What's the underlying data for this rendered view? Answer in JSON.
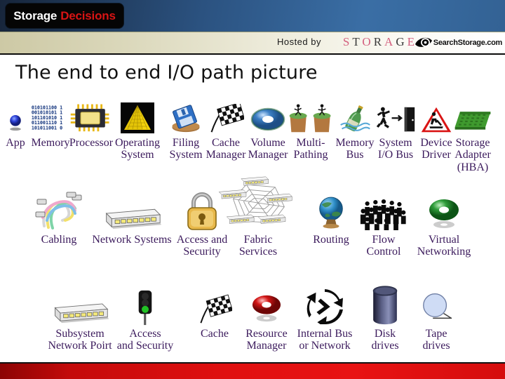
{
  "header": {
    "logo_primary": "Storage",
    "logo_secondary": "Decisions",
    "hosted_by": "Hosted by",
    "storage_word": "STORAGE",
    "search_brand": "SearchStorage.com",
    "colors": {
      "band_blue": "#2b5280",
      "band_tan": "#dbd8bb",
      "logo_red": "#d91414",
      "footer_red": "#e01010",
      "label_purple": "#3b1a5c"
    }
  },
  "slide": {
    "title": "The end to end I/O path picture"
  },
  "rows": [
    {
      "name": "host-io-path-row",
      "items": [
        {
          "label": "App",
          "icon": "blue-sphere-icon"
        },
        {
          "label": "Memory",
          "icon": "binary-digits-icon"
        },
        {
          "label": "Processor",
          "icon": "cpu-chip-icon"
        },
        {
          "label": "Operating\nSystem",
          "icon": "yellow-pyramid-icon"
        },
        {
          "label": "Filing\nSystem",
          "icon": "floppy-disk-icon"
        },
        {
          "label": "Cache\nManager",
          "icon": "checkered-flag-icon"
        },
        {
          "label": "Volume\nManager",
          "icon": "torus-ring-icon"
        },
        {
          "label": "Multi-\nPathing",
          "icon": "two-cliff-hikers-icon"
        },
        {
          "label": "Memory\nBus",
          "icon": "champagne-bottle-icon"
        },
        {
          "label": "System\nI/O Bus",
          "icon": "runner-door-icon"
        },
        {
          "label": "Device\nDriver",
          "icon": "roadworks-sign-icon"
        },
        {
          "label": "Storage\nAdapter\n(HBA)",
          "icon": "green-board-icon"
        }
      ]
    },
    {
      "name": "network-fabric-row",
      "items": [
        {
          "label": "Cabling",
          "icon": "tangled-cables-icon"
        },
        {
          "label": "Network Systems",
          "icon": "switch-device-icon"
        },
        {
          "label": "Access and\nSecurity",
          "icon": "padlock-icon"
        },
        {
          "label": "Fabric\nServices",
          "icon": "mesh-fabric-icon"
        },
        {
          "label": "Routing",
          "icon": "globe-icon"
        },
        {
          "label": "Flow\nControl",
          "icon": "crowd-people-icon"
        },
        {
          "label": "Virtual\nNetworking",
          "icon": "green-torus-icon"
        }
      ]
    },
    {
      "name": "storage-subsystem-row",
      "items": [
        {
          "label": "Subsystem\nNetwork Poirt",
          "icon": "switch-device-icon"
        },
        {
          "label": "Access\nand Security",
          "icon": "traffic-light-icon"
        },
        {
          "label": "Cache",
          "icon": "checkered-flag-icon"
        },
        {
          "label": "Resource\nManager",
          "icon": "red-torus-icon"
        },
        {
          "label": "Internal Bus\nor Network",
          "icon": "recycle-arrows-icon"
        },
        {
          "label": "Disk\ndrives",
          "icon": "disk-cylinder-icon"
        },
        {
          "label": "Tape\ndrives",
          "icon": "tape-reel-icon"
        }
      ]
    }
  ]
}
